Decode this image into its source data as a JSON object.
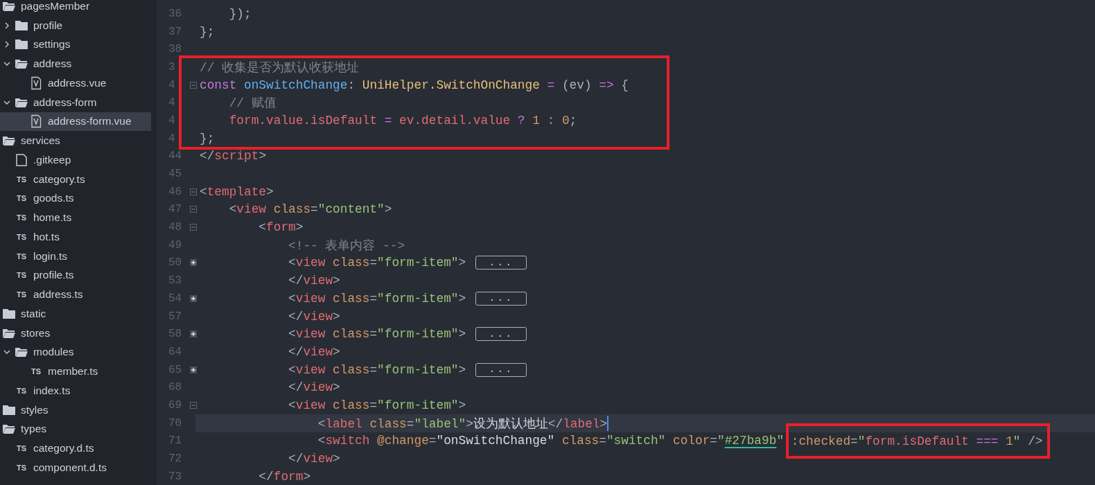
{
  "sidebar": {
    "items": [
      {
        "kind": "folder",
        "label": "pagesMember",
        "expanded": true,
        "selected": false,
        "children": [
          {
            "kind": "folder",
            "label": "profile",
            "expanded": false,
            "selected": false
          },
          {
            "kind": "folder",
            "label": "settings",
            "expanded": false,
            "selected": false
          },
          {
            "kind": "folder",
            "label": "address",
            "expanded": true,
            "selected": false,
            "children": [
              {
                "kind": "vue",
                "label": "address.vue",
                "selected": false
              }
            ]
          },
          {
            "kind": "folder",
            "label": "address-form",
            "expanded": true,
            "selected": false,
            "children": [
              {
                "kind": "vue",
                "label": "address-form.vue",
                "selected": true
              }
            ]
          }
        ]
      },
      {
        "kind": "folder",
        "label": "services",
        "expanded": true,
        "selected": false,
        "children": [
          {
            "kind": "plain",
            "label": ".gitkeep",
            "selected": false
          },
          {
            "kind": "ts",
            "badge": "TS",
            "label": "category.ts",
            "selected": false
          },
          {
            "kind": "ts",
            "badge": "TS",
            "label": "goods.ts",
            "selected": false
          },
          {
            "kind": "ts",
            "badge": "TS",
            "label": "home.ts",
            "selected": false
          },
          {
            "kind": "ts",
            "badge": "TS",
            "label": "hot.ts",
            "selected": false
          },
          {
            "kind": "ts",
            "badge": "TS",
            "label": "login.ts",
            "selected": false
          },
          {
            "kind": "ts",
            "badge": "TS",
            "label": "profile.ts",
            "selected": false
          },
          {
            "kind": "ts",
            "badge": "TS",
            "label": "address.ts",
            "selected": false
          }
        ]
      },
      {
        "kind": "folder",
        "label": "static",
        "expanded": false,
        "selected": false
      },
      {
        "kind": "folder",
        "label": "stores",
        "expanded": true,
        "selected": false,
        "children": [
          {
            "kind": "folder",
            "label": "modules",
            "expanded": true,
            "selected": false,
            "children": [
              {
                "kind": "ts",
                "badge": "TS",
                "label": "member.ts",
                "selected": false
              }
            ]
          },
          {
            "kind": "ts",
            "badge": "TS",
            "label": "index.ts",
            "selected": false
          }
        ]
      },
      {
        "kind": "folder",
        "label": "styles",
        "expanded": false,
        "selected": false
      },
      {
        "kind": "folder",
        "label": "types",
        "expanded": true,
        "selected": false,
        "children": [
          {
            "kind": "ts",
            "badge": "TS",
            "label": "category.d.ts",
            "selected": false
          },
          {
            "kind": "ts",
            "badge": "TS",
            "label": "component.d.ts",
            "selected": false
          }
        ]
      }
    ]
  },
  "editor": {
    "lines": [
      {
        "kind": "plain",
        "number": "36",
        "current": false,
        "tokens": [
          {
            "t": "    });",
            "kind": "punct"
          }
        ]
      },
      {
        "kind": "plain",
        "number": "37",
        "current": false,
        "tokens": [
          {
            "t": "};",
            "kind": "punct"
          }
        ]
      },
      {
        "kind": "plain",
        "number": "38",
        "current": false
      },
      {
        "kind": "boxed",
        "lines": [
          {
            "kind": "plain",
            "number": "3",
            "current": false,
            "tokens": [
              {
                "t": "// 收集是否为默认收获地址",
                "kind": "comment"
              }
            ]
          },
          {
            "kind": "fold-start",
            "number": "4",
            "current": false,
            "tokens": [
              {
                "t": "const ",
                "kind": "keyword"
              },
              {
                "t": "onSwitchChange",
                "kind": "fn"
              },
              {
                "t": ": ",
                "kind": "punct"
              },
              {
                "t": "UniHelper.SwitchOnChange",
                "kind": "type"
              },
              {
                "t": " = ",
                "kind": "op"
              },
              {
                "t": "(ev) ",
                "kind": "punct"
              },
              {
                "t": "=>",
                "kind": "op"
              },
              {
                "t": " {",
                "kind": "punct"
              }
            ]
          },
          {
            "kind": "plain",
            "number": "4",
            "current": false,
            "tokens": [
              {
                "t": "    // 赋值",
                "kind": "comment"
              }
            ]
          },
          {
            "kind": "plain",
            "number": "4",
            "current": false,
            "tokens": [
              {
                "t": "    form.value.isDefault",
                "kind": "var"
              },
              {
                "t": " = ",
                "kind": "op"
              },
              {
                "t": "ev.detail.value",
                "kind": "var"
              },
              {
                "t": " ? ",
                "kind": "op"
              },
              {
                "t": "1",
                "kind": "num"
              },
              {
                "t": " : ",
                "kind": "op"
              },
              {
                "t": "0",
                "kind": "num"
              },
              {
                "t": ";",
                "kind": "punct"
              }
            ]
          },
          {
            "kind": "plain",
            "number": "4",
            "current": false,
            "tokens": [
              {
                "t": "};",
                "kind": "punct"
              }
            ]
          }
        ]
      },
      {
        "kind": "plain",
        "number": "44",
        "current": false,
        "tokens": [
          {
            "t": "</",
            "kind": "punct"
          },
          {
            "t": "script",
            "kind": "tag"
          },
          {
            "t": ">",
            "kind": "punct"
          }
        ]
      },
      {
        "kind": "plain",
        "number": "45",
        "current": false
      },
      {
        "kind": "fold-start",
        "number": "46",
        "current": false,
        "tokens": [
          {
            "t": "<",
            "kind": "punct"
          },
          {
            "t": "template",
            "kind": "tag"
          },
          {
            "t": ">",
            "kind": "punct"
          }
        ]
      },
      {
        "kind": "fold-start",
        "number": "47",
        "current": false,
        "tokens": [
          {
            "t": "    <",
            "kind": "punct"
          },
          {
            "t": "view ",
            "kind": "tag"
          },
          {
            "t": "class",
            "kind": "attr"
          },
          {
            "t": "=",
            "kind": "punct"
          },
          {
            "t": "\"content\"",
            "kind": "string"
          },
          {
            "t": ">",
            "kind": "punct"
          }
        ]
      },
      {
        "kind": "fold-start",
        "number": "48",
        "current": false,
        "tokens": [
          {
            "t": "        <",
            "kind": "punct"
          },
          {
            "t": "form",
            "kind": "tag"
          },
          {
            "t": ">",
            "kind": "punct"
          }
        ]
      },
      {
        "kind": "plain",
        "number": "49",
        "current": false,
        "tokens": [
          {
            "t": "            <!-- 表单内容 -->",
            "kind": "comment"
          }
        ]
      },
      {
        "kind": "folded",
        "number": "50",
        "folded_text": "...",
        "current": false,
        "tokens": [
          {
            "t": "            <",
            "kind": "punct"
          },
          {
            "t": "view ",
            "kind": "tag"
          },
          {
            "t": "class",
            "kind": "attr"
          },
          {
            "t": "=",
            "kind": "punct"
          },
          {
            "t": "\"form-item\"",
            "kind": "string"
          },
          {
            "t": ">",
            "kind": "punct"
          }
        ]
      },
      {
        "kind": "plain",
        "number": "53",
        "current": false,
        "tokens": [
          {
            "t": "            </",
            "kind": "punct"
          },
          {
            "t": "view",
            "kind": "tag"
          },
          {
            "t": ">",
            "kind": "punct"
          }
        ]
      },
      {
        "kind": "folded",
        "number": "54",
        "folded_text": "...",
        "current": false,
        "tokens": [
          {
            "t": "            <",
            "kind": "punct"
          },
          {
            "t": "view ",
            "kind": "tag"
          },
          {
            "t": "class",
            "kind": "attr"
          },
          {
            "t": "=",
            "kind": "punct"
          },
          {
            "t": "\"form-item\"",
            "kind": "string"
          },
          {
            "t": ">",
            "kind": "punct"
          }
        ]
      },
      {
        "kind": "plain",
        "number": "57",
        "current": false,
        "tokens": [
          {
            "t": "            </",
            "kind": "punct"
          },
          {
            "t": "view",
            "kind": "tag"
          },
          {
            "t": ">",
            "kind": "punct"
          }
        ]
      },
      {
        "kind": "folded",
        "number": "58",
        "folded_text": "...",
        "current": false,
        "tokens": [
          {
            "t": "            <",
            "kind": "punct"
          },
          {
            "t": "view ",
            "kind": "tag"
          },
          {
            "t": "class",
            "kind": "attr"
          },
          {
            "t": "=",
            "kind": "punct"
          },
          {
            "t": "\"form-item\"",
            "kind": "string"
          },
          {
            "t": ">",
            "kind": "punct"
          }
        ]
      },
      {
        "kind": "plain",
        "number": "64",
        "current": false,
        "tokens": [
          {
            "t": "            </",
            "kind": "punct"
          },
          {
            "t": "view",
            "kind": "tag"
          },
          {
            "t": ">",
            "kind": "punct"
          }
        ]
      },
      {
        "kind": "folded",
        "number": "65",
        "folded_text": "...",
        "current": false,
        "tokens": [
          {
            "t": "            <",
            "kind": "punct"
          },
          {
            "t": "view ",
            "kind": "tag"
          },
          {
            "t": "class",
            "kind": "attr"
          },
          {
            "t": "=",
            "kind": "punct"
          },
          {
            "t": "\"form-item\"",
            "kind": "string"
          },
          {
            "t": ">",
            "kind": "punct"
          }
        ]
      },
      {
        "kind": "plain",
        "number": "68",
        "current": false,
        "tokens": [
          {
            "t": "            </",
            "kind": "punct"
          },
          {
            "t": "view",
            "kind": "tag"
          },
          {
            "t": ">",
            "kind": "punct"
          }
        ]
      },
      {
        "kind": "fold-start",
        "number": "69",
        "current": false,
        "tokens": [
          {
            "t": "            <",
            "kind": "punct"
          },
          {
            "t": "view ",
            "kind": "tag"
          },
          {
            "t": "class",
            "kind": "attr"
          },
          {
            "t": "=",
            "kind": "punct"
          },
          {
            "t": "\"form-item\"",
            "kind": "string"
          },
          {
            "t": ">",
            "kind": "punct"
          }
        ]
      },
      {
        "kind": "plain",
        "number": "70",
        "current": true,
        "tokens": [
          {
            "t": "                <",
            "kind": "punct"
          },
          {
            "t": "label ",
            "kind": "tag"
          },
          {
            "t": "class",
            "kind": "attr"
          },
          {
            "t": "=",
            "kind": "punct"
          },
          {
            "t": "\"label\"",
            "kind": "string"
          },
          {
            "t": ">",
            "kind": "punct"
          },
          {
            "t": "设为默认地址",
            "kind": "text"
          },
          {
            "t": "</",
            "kind": "punct"
          },
          {
            "t": "label",
            "kind": "tag"
          },
          {
            "t": ">",
            "kind": "punct"
          },
          {
            "kind": "cursor"
          }
        ]
      },
      {
        "kind": "plain",
        "number": "71",
        "current": false,
        "tokens": [
          {
            "t": "                <",
            "kind": "punct"
          },
          {
            "t": "switch ",
            "kind": "tag"
          },
          {
            "t": "@change",
            "kind": "attr"
          },
          {
            "t": "=",
            "kind": "punct"
          },
          {
            "t": "\"onSwitchChange\"",
            "kind": "text"
          },
          {
            "t": " class",
            "kind": "attr"
          },
          {
            "t": "=",
            "kind": "punct"
          },
          {
            "t": "\"switch\"",
            "kind": "string"
          },
          {
            "t": " color",
            "kind": "attr"
          },
          {
            "t": "=",
            "kind": "punct"
          },
          {
            "t": "\"",
            "kind": "string"
          },
          {
            "t": "#27ba9b",
            "kind": "color"
          },
          {
            "t": "\" ",
            "kind": "string"
          },
          {
            "kind": "boxed",
            "tokens": [
              {
                "t": ":checked",
                "kind": "attr"
              },
              {
                "t": "=",
                "kind": "punct"
              },
              {
                "t": "\"",
                "kind": "string"
              },
              {
                "t": "form.isDefault",
                "kind": "var"
              },
              {
                "t": " === ",
                "kind": "op"
              },
              {
                "t": "1",
                "kind": "num"
              },
              {
                "t": "\"",
                "kind": "string"
              },
              {
                "t": " />",
                "kind": "punct"
              }
            ]
          }
        ]
      },
      {
        "kind": "plain",
        "number": "72",
        "current": false,
        "tokens": [
          {
            "t": "            </",
            "kind": "punct"
          },
          {
            "t": "view",
            "kind": "tag"
          },
          {
            "t": ">",
            "kind": "punct"
          }
        ]
      },
      {
        "kind": "plain",
        "number": "73",
        "current": false,
        "tokens": [
          {
            "t": "        </",
            "kind": "punct"
          },
          {
            "t": "form",
            "kind": "tag"
          },
          {
            "t": ">",
            "kind": "punct"
          }
        ]
      }
    ]
  }
}
